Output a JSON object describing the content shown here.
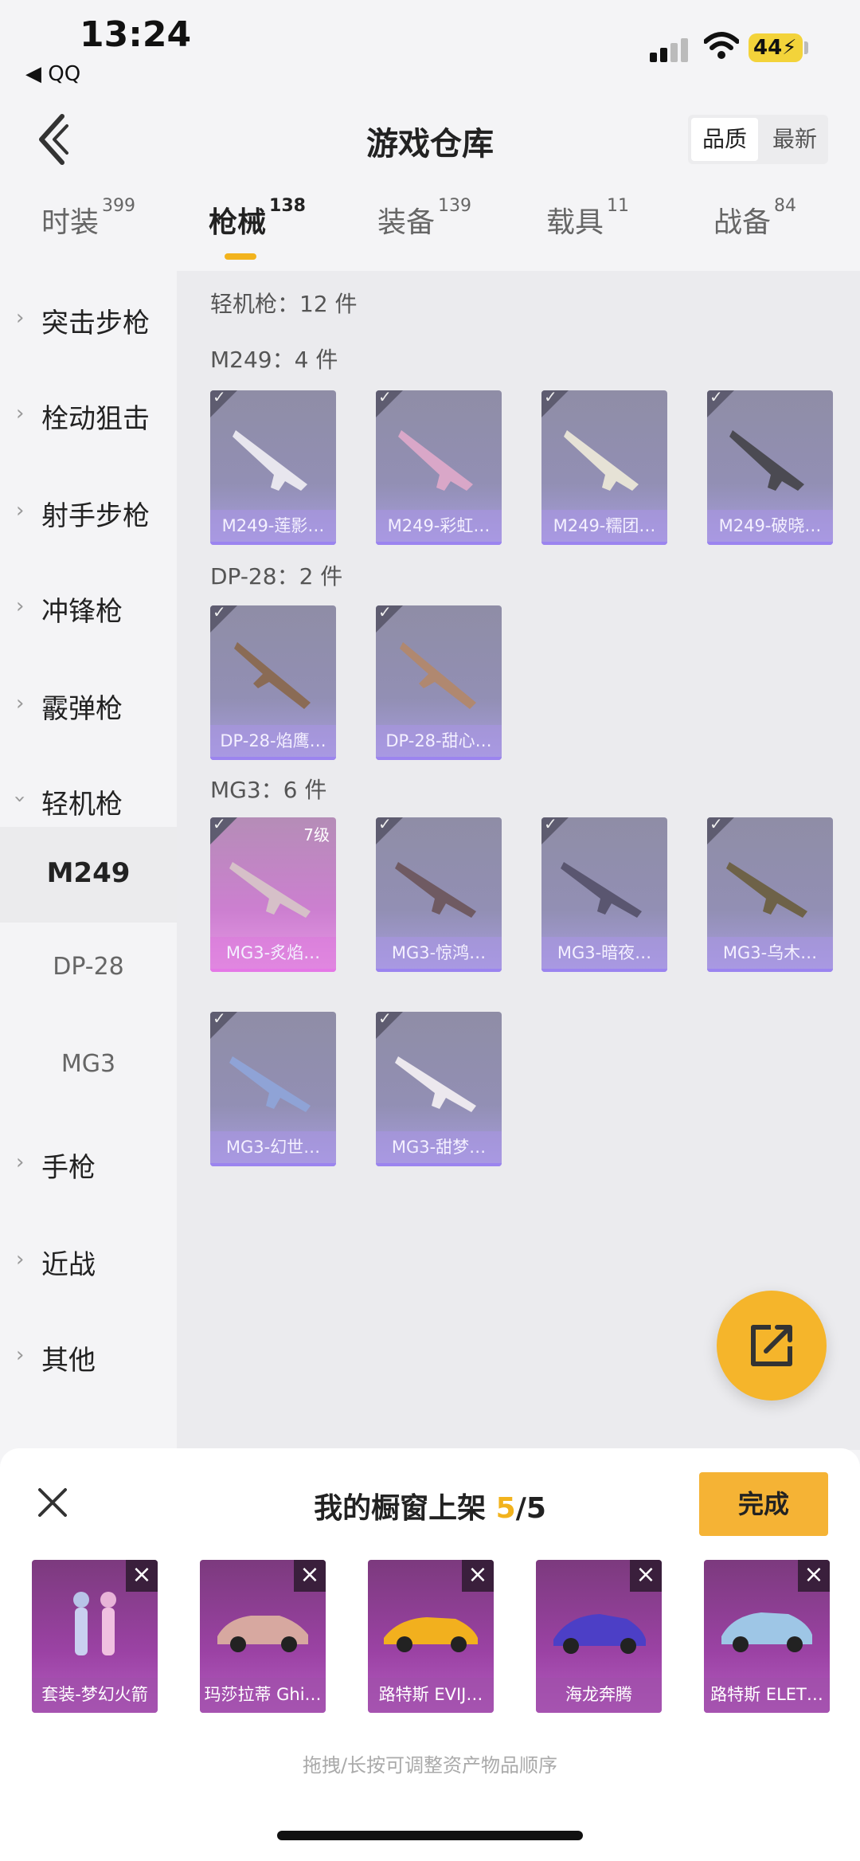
{
  "status": {
    "time": "13:24",
    "back_app": "◀ QQ",
    "battery": "44"
  },
  "header": {
    "title": "游戏仓库",
    "sort_options": [
      "品质",
      "最新"
    ]
  },
  "tabs": [
    {
      "label": "时装",
      "count": "399"
    },
    {
      "label": "枪械",
      "count": "138"
    },
    {
      "label": "装备",
      "count": "139"
    },
    {
      "label": "载具",
      "count": "11"
    },
    {
      "label": "战备",
      "count": "84"
    }
  ],
  "sidebar": {
    "items": [
      "突击步枪",
      "栓动狙击",
      "射手步枪",
      "冲锋枪",
      "霰弹枪",
      "轻机枪"
    ],
    "sub_items": [
      "M249",
      "DP-28",
      "MG3"
    ],
    "items_after": [
      "手枪",
      "近战",
      "其他"
    ]
  },
  "content": {
    "category_title": "轻机枪：12 件",
    "groups": [
      {
        "title": "M249：4 件",
        "cards": [
          "M249-莲影…",
          "M249-彩虹…",
          "M249-糯团…",
          "M249-破晓…"
        ]
      },
      {
        "title": "DP-28：2 件",
        "cards": [
          "DP-28-焰鹰…",
          "DP-28-甜心…"
        ]
      },
      {
        "title": "MG3：6 件",
        "cards": [
          "MG3-炙焰…",
          "MG3-惊鸿…",
          "MG3-暗夜…",
          "MG3-乌木…",
          "MG3-幻世…",
          "MG3-甜梦…"
        ]
      }
    ],
    "level_badge": "7级"
  },
  "sheet": {
    "title_prefix": "我的橱窗上架 ",
    "count_current": "5",
    "count_total": "/5",
    "done_label": "完成",
    "items": [
      "套装-梦幻火箭",
      "玛莎拉蒂 Ghi…",
      "路特斯 EVIJ…",
      "海龙奔腾",
      "路特斯 ELET…"
    ],
    "hint": "拖拽/长按可调整资产物品顺序"
  },
  "colors": {
    "accent": "#f2b31d",
    "fab": "#f5b52b",
    "card_purple": "#928fb4",
    "shelf_purple": "#9b42a4"
  }
}
